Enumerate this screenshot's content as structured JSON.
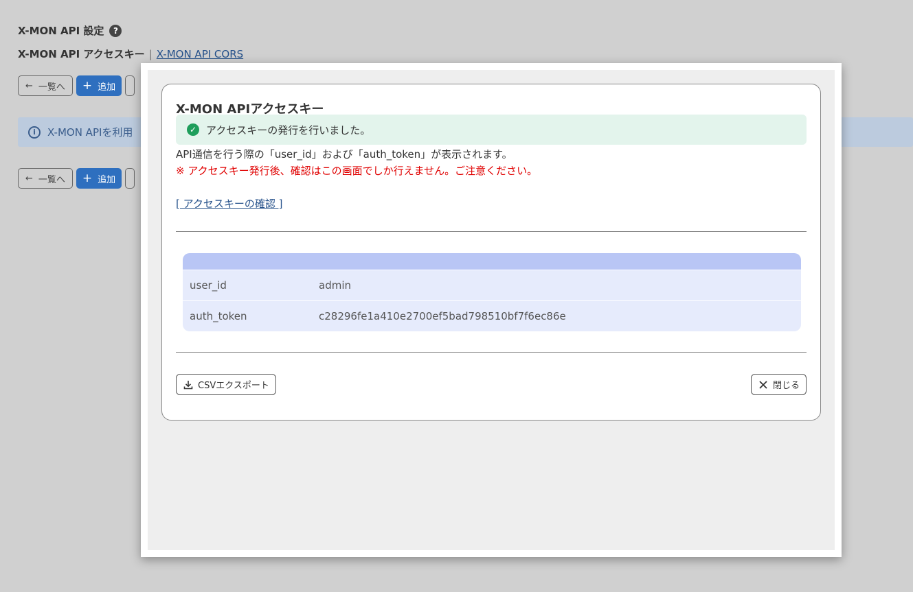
{
  "background": {
    "title": "X-MON API 設定",
    "help_icon": "question-circle-icon",
    "subnav": {
      "current": "X-MON API アクセスキー",
      "separator": "|",
      "link": "X-MON API CORS"
    },
    "toolbar": {
      "back_label": "一覧へ",
      "add_label": "追加"
    },
    "info_text": "X-MON APIを利用"
  },
  "modal": {
    "title": "X-MON APIアクセスキー",
    "success_message": "アクセスキーの発行を行いました。",
    "description": "API通信を行う際の「user_id」および「auth_token」が表示されます。",
    "warning": "※ アクセスキー発行後、確認はこの画面でしか行えません。ご注意ください。",
    "confirm_link": "[ アクセスキーの確認 ]",
    "table": {
      "rows": [
        {
          "key": "user_id",
          "value": "admin"
        },
        {
          "key": "auth_token",
          "value": "c28296fe1a410e2700ef5bad798510bf7f6ec86e"
        }
      ]
    },
    "csv_button": "CSVエクスポート",
    "close_button": "閉じる"
  },
  "colors": {
    "primary": "#2e6fbf",
    "success_bg": "#e3f4ec",
    "success_icon": "#1e9e5b",
    "warning_text": "#e00000",
    "table_header": "#b9c6f5",
    "table_row": "#e6ebfc"
  }
}
